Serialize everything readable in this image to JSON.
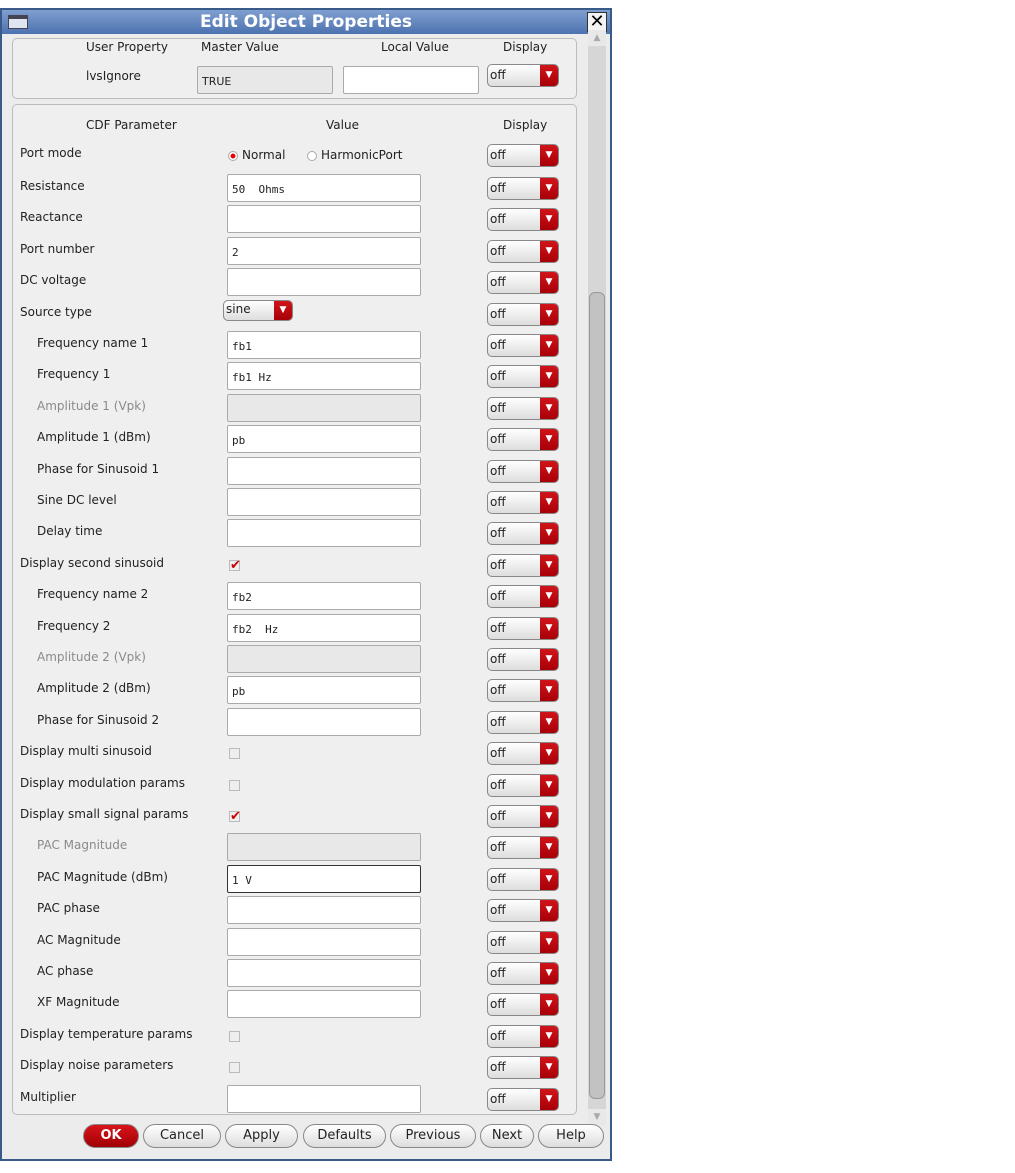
{
  "window": {
    "title": "Edit Object Properties"
  },
  "user_props": {
    "headers": [
      "User Property",
      "Master Value",
      "Local Value",
      "Display"
    ],
    "row": {
      "name": "lvsIgnore",
      "master": "TRUE",
      "local": "",
      "display": "off"
    }
  },
  "cdf": {
    "headers": [
      "CDF Parameter",
      "Value",
      "Display"
    ],
    "rows": [
      {
        "label": "Port mode",
        "type": "radio",
        "options": [
          "Normal",
          "HarmonicPort"
        ],
        "selected": 0,
        "display": "off"
      },
      {
        "label": "Resistance",
        "type": "input",
        "value": "50  Ohms",
        "display": "off"
      },
      {
        "label": "Reactance",
        "type": "input",
        "value": "",
        "display": "off"
      },
      {
        "label": "Port number",
        "type": "input",
        "value": "2",
        "display": "off"
      },
      {
        "label": "DC voltage",
        "type": "input",
        "value": "",
        "display": "off"
      },
      {
        "label": "Source type",
        "type": "select",
        "value": "sine",
        "display": "off"
      },
      {
        "label": "Frequency name 1",
        "type": "input",
        "value": "fb1",
        "indent": true,
        "display": "off"
      },
      {
        "label": "Frequency 1",
        "type": "input",
        "value": "fb1 Hz",
        "indent": true,
        "display": "off"
      },
      {
        "label": "Amplitude 1 (Vpk)",
        "type": "input",
        "value": "",
        "indent": true,
        "disabled": true,
        "display": "off"
      },
      {
        "label": "Amplitude 1 (dBm)",
        "type": "input",
        "value": "pb",
        "indent": true,
        "display": "off"
      },
      {
        "label": "Phase for Sinusoid 1",
        "type": "input",
        "value": "",
        "indent": true,
        "display": "off"
      },
      {
        "label": "Sine DC level",
        "type": "input",
        "value": "",
        "indent": true,
        "display": "off"
      },
      {
        "label": "Delay time",
        "type": "input",
        "value": "",
        "indent": true,
        "display": "off"
      },
      {
        "label": "Display second sinusoid",
        "type": "checkbox",
        "checked": true,
        "display": "off"
      },
      {
        "label": "Frequency name 2",
        "type": "input",
        "value": "fb2",
        "indent": true,
        "display": "off"
      },
      {
        "label": "Frequency 2",
        "type": "input",
        "value": "fb2  Hz",
        "indent": true,
        "display": "off"
      },
      {
        "label": "Amplitude 2 (Vpk)",
        "type": "input",
        "value": "",
        "indent": true,
        "disabled": true,
        "display": "off"
      },
      {
        "label": "Amplitude 2 (dBm)",
        "type": "input",
        "value": "pb",
        "indent": true,
        "display": "off"
      },
      {
        "label": "Phase for Sinusoid 2",
        "type": "input",
        "value": "",
        "indent": true,
        "display": "off"
      },
      {
        "label": "Display multi sinusoid",
        "type": "checkbox",
        "checked": false,
        "display": "off"
      },
      {
        "label": "Display modulation params",
        "type": "checkbox",
        "checked": false,
        "display": "off"
      },
      {
        "label": "Display small signal params",
        "type": "checkbox",
        "checked": true,
        "display": "off"
      },
      {
        "label": "PAC Magnitude",
        "type": "input",
        "value": "",
        "indent": true,
        "disabled": true,
        "display": "off"
      },
      {
        "label": "PAC Magnitude (dBm)",
        "type": "input",
        "value": "1 V",
        "indent": true,
        "focused": true,
        "display": "off"
      },
      {
        "label": "PAC phase",
        "type": "input",
        "value": "",
        "indent": true,
        "display": "off"
      },
      {
        "label": "AC Magnitude",
        "type": "input",
        "value": "",
        "indent": true,
        "display": "off"
      },
      {
        "label": "AC phase",
        "type": "input",
        "value": "",
        "indent": true,
        "display": "off"
      },
      {
        "label": "XF Magnitude",
        "type": "input",
        "value": "",
        "indent": true,
        "display": "off"
      },
      {
        "label": "Display temperature params",
        "type": "checkbox",
        "checked": false,
        "display": "off"
      },
      {
        "label": "Display noise parameters",
        "type": "checkbox",
        "checked": false,
        "display": "off"
      },
      {
        "label": "Multiplier",
        "type": "input",
        "value": "",
        "display": "off"
      }
    ]
  },
  "buttons": [
    {
      "id": "ok",
      "label": "OK"
    },
    {
      "id": "cancel",
      "label": "Cancel"
    },
    {
      "id": "apply",
      "label": "Apply"
    },
    {
      "id": "defaults",
      "label": "Defaults"
    },
    {
      "id": "previous",
      "label": "Previous"
    },
    {
      "id": "next",
      "label": "Next"
    },
    {
      "id": "help",
      "label": "Help"
    }
  ],
  "icons": {
    "arrow": "▼",
    "check": "✔",
    "close": "✕",
    "scroll_up": "▲",
    "scroll_down": "▼"
  },
  "colors": {
    "accent": "#c0101a",
    "title": "#5a7cb8"
  }
}
